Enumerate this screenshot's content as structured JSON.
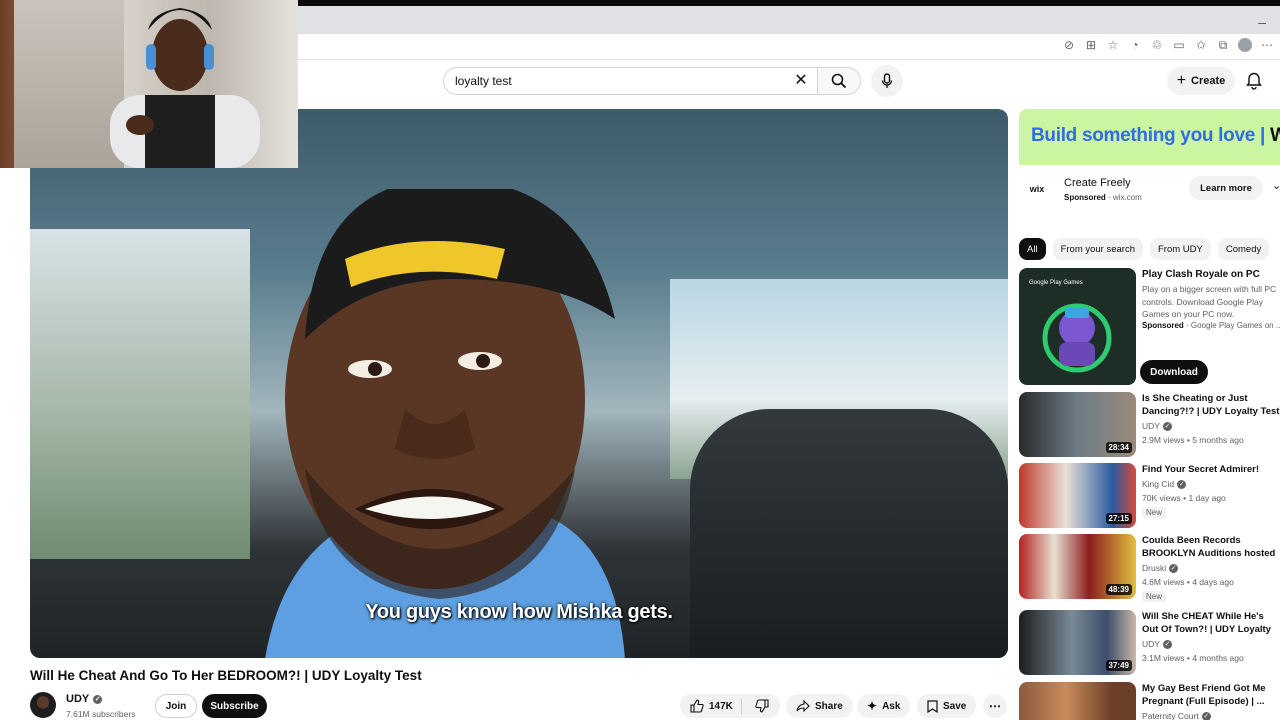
{
  "search": {
    "query": "loyalty test"
  },
  "header": {
    "create_label": "Create"
  },
  "video": {
    "subtitle": "You guys know how Mishka gets.",
    "title": "Will He Cheat And Go To Her BEDROOM?! | UDY Loyalty Test",
    "channel": "UDY",
    "subscribers": "7.61M subscribers",
    "join_label": "Join",
    "subscribe_label": "Subscribe",
    "likes": "147K",
    "share_label": "Share",
    "ask_label": "Ask",
    "save_label": "Save"
  },
  "ad": {
    "headline": "Build something you love",
    "brand_mark": "WIX",
    "logo_text": "wix",
    "name": "Create Freely",
    "sponsored": "Sponsored",
    "domain": "wix.com",
    "cta": "Learn more"
  },
  "chips": [
    {
      "label": "All"
    },
    {
      "label": "From your search"
    },
    {
      "label": "From UDY"
    },
    {
      "label": "Comedy"
    }
  ],
  "sponsored_card": {
    "title": "Play Clash Royale on PC",
    "description": "Play on a bigger screen with full PC controls. Download Google Play Games on your PC now.",
    "sponsored": "Sponsored",
    "advertiser": "Google Play Games on ...",
    "cta": "Download",
    "thumb_logo": "Google Play Games"
  },
  "recommendations": [
    {
      "title": "Is She Cheating or Just Dancing?!? | UDY Loyalty Test",
      "channel": "UDY",
      "verified": true,
      "stats": "2.9M views • 5 months ago",
      "duration": "28:34",
      "badge": ""
    },
    {
      "title": "Find Your Secret Admirer!",
      "channel": "King Cid",
      "verified": true,
      "stats": "70K views • 1 day ago",
      "duration": "27:15",
      "badge": "New"
    },
    {
      "title": "Coulda Been Records BROOKLYN Auditions hosted b...",
      "channel": "Druski",
      "verified": true,
      "stats": "4.6M views • 4 days ago",
      "duration": "48:39",
      "badge": "New"
    },
    {
      "title": "Will She CHEAT While He's Out Of Town?! | UDY Loyalty Test",
      "channel": "UDY",
      "verified": true,
      "stats": "3.1M views • 4 months ago",
      "duration": "37:49",
      "badge": ""
    },
    {
      "title": "My Gay Best Friend Got Me Pregnant (Full Episode) | ...",
      "channel": "Paternity Court",
      "verified": true,
      "stats": "",
      "duration": "",
      "badge": ""
    }
  ],
  "colors": {
    "ad_bg": "#ccf5a2",
    "ad_text": "#2f6ce5",
    "accent_dark": "#0f0f0f"
  }
}
